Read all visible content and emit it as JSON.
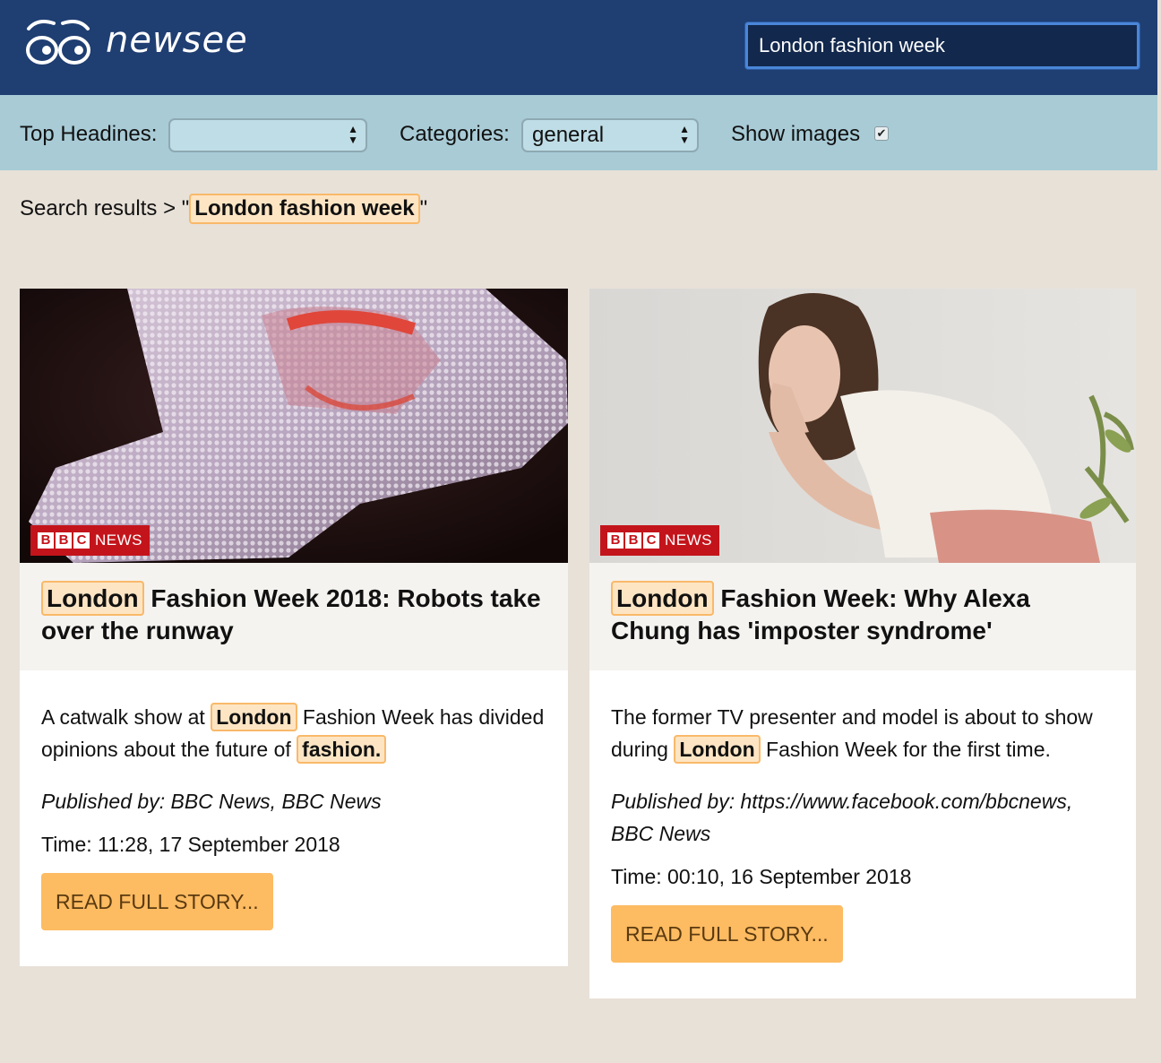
{
  "header": {
    "logo_text": "newsee",
    "search_value": "London fashion week"
  },
  "filters": {
    "top_headlines_label": "Top Headines:",
    "top_headlines_value": "",
    "categories_label": "Categories:",
    "categories_value": "general",
    "show_images_label": "Show images",
    "show_images_checked": true
  },
  "breadcrumb": {
    "prefix": "Search results > \"",
    "query": "London fashion week",
    "suffix": "\""
  },
  "articles": [
    {
      "title_highlight": "London",
      "title_rest": "Fashion Week 2018: Robots take over the runway",
      "desc_1": "A catwalk show at",
      "desc_hl_1": "London",
      "desc_2": "Fashion Week has divided opinions about the future of",
      "desc_hl_2": "fashion.",
      "published": "Published by: BBC News, BBC News",
      "time": "Time: 11:28, 17 September 2018",
      "button": "READ FULL STORY...",
      "badge": "NEWS"
    },
    {
      "title_highlight": "London",
      "title_rest": "Fashion Week: Why Alexa Chung has 'imposter syndrome'",
      "desc_1": "The former TV presenter and model is about to show during",
      "desc_hl_1": "London",
      "desc_2": "Fashion Week for the first time.",
      "published": "Published by: https://www.facebook.com/bbcnews, BBC News",
      "time": "Time: 00:10, 16 September 2018",
      "button": "READ FULL STORY...",
      "badge": "NEWS"
    }
  ],
  "colors": {
    "header_bg": "#1f3e72",
    "filterbar_bg": "#a8cbd6",
    "page_bg": "#e8e1d8",
    "highlight_bg": "#fde5c4",
    "button_bg": "#fdbb62",
    "bbc_red": "#c4141b"
  }
}
